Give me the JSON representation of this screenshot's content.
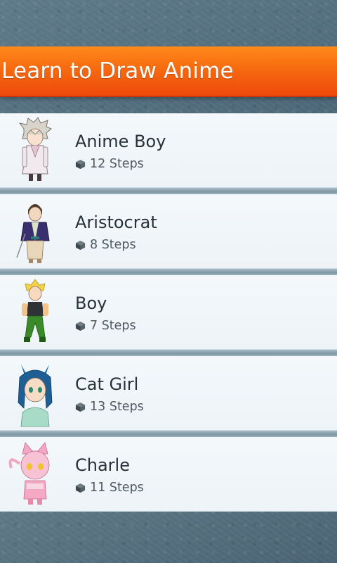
{
  "app": {
    "title": "Learn to Draw Anime"
  },
  "items": [
    {
      "title": "Anime Boy",
      "steps": "12 Steps",
      "icon": "anime-boy-thumbnail"
    },
    {
      "title": "Aristocrat",
      "steps": "8 Steps",
      "icon": "aristocrat-thumbnail"
    },
    {
      "title": "Boy",
      "steps": "7 Steps",
      "icon": "boy-thumbnail"
    },
    {
      "title": "Cat Girl",
      "steps": "13 Steps",
      "icon": "cat-girl-thumbnail"
    },
    {
      "title": "Charle",
      "steps": "11 Steps",
      "icon": "charle-thumbnail"
    }
  ],
  "colors": {
    "header": "#f66a10",
    "list_bg": "#f0f5f9",
    "title_text": "#263238"
  }
}
